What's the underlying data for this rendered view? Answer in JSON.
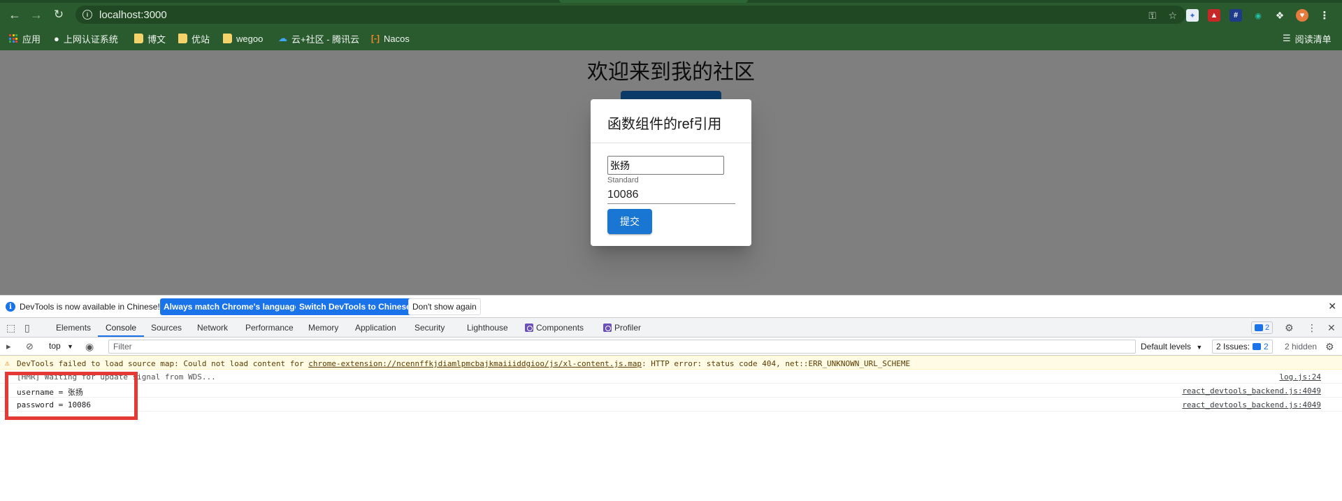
{
  "browser": {
    "url": "localhost:3000",
    "bookmarks": [
      {
        "label": "应用",
        "icon": "apps-grid-icon"
      },
      {
        "label": "上网认证系统",
        "icon": "globe-icon"
      },
      {
        "label": "博文",
        "icon": "folder-icon"
      },
      {
        "label": "优站",
        "icon": "folder-icon"
      },
      {
        "label": "wegoo",
        "icon": "folder-icon"
      },
      {
        "label": "云+社区 - 腾讯云",
        "icon": "tencent-cloud-icon"
      },
      {
        "label": "Nacos",
        "icon": "nacos-icon"
      }
    ],
    "reading_list": "阅读清单"
  },
  "page": {
    "heading": "欢迎来到我的社区",
    "dialog": {
      "title": "函数组件的ref引用",
      "username_value": "张扬",
      "helper_text": "Standard",
      "password_value": "10086",
      "submit_label": "提交"
    }
  },
  "devtools": {
    "infobar": {
      "message": "DevTools is now available in Chinese!",
      "match_language": "Always match Chrome's language",
      "switch_chinese": "Switch DevTools to Chinese",
      "dont_show": "Don't show again"
    },
    "tabs": [
      "Elements",
      "Console",
      "Sources",
      "Network",
      "Performance",
      "Memory",
      "Application",
      "Security",
      "Lighthouse",
      "Components",
      "Profiler"
    ],
    "active_tab": "Console",
    "message_count": "2",
    "console_toolbar": {
      "context": "top",
      "filter_placeholder": "Filter",
      "levels": "Default levels",
      "issues_label": "2 Issues:",
      "issues_count": "2",
      "hidden": "2 hidden"
    },
    "logs": {
      "warning": {
        "prefix": "DevTools failed to load source map: Could not load content for ",
        "link": "chrome-extension://ncennffkjdiamlpmcbajkmaiiiddgioo/js/xl-content.js.map",
        "suffix": ": HTTP error: status code 404, net::ERR_UNKNOWN_URL_SCHEME"
      },
      "rows": [
        {
          "text": "[HMR] Waiting for update signal from WDS...",
          "source": "log.js:24"
        },
        {
          "text": "username = 张扬",
          "source": "react_devtools_backend.js:4049"
        },
        {
          "text": "password = 10086",
          "source": "react_devtools_backend.js:4049"
        }
      ]
    }
  },
  "colors": {
    "chrome_frame": "#295b2e",
    "primary_button": "#1976d2",
    "highlight": "#e53935"
  }
}
